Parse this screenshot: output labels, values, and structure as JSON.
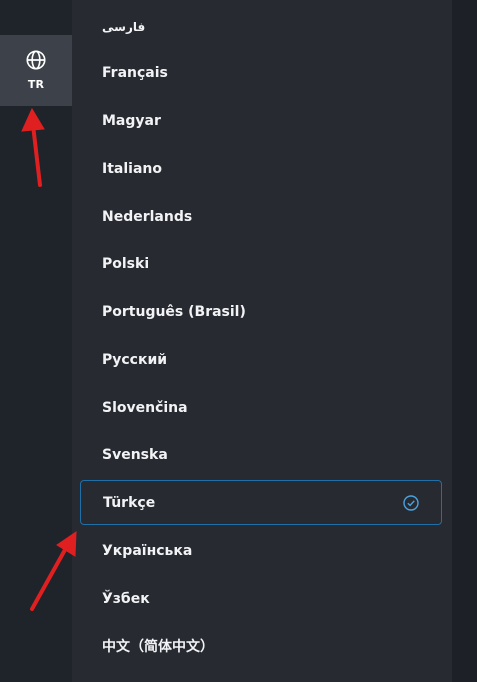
{
  "language_button": {
    "code": "TR",
    "icon": "globe-icon"
  },
  "languages": [
    {
      "label": "فارسی",
      "selected": false
    },
    {
      "label": "Français",
      "selected": false
    },
    {
      "label": "Magyar",
      "selected": false
    },
    {
      "label": "Italiano",
      "selected": false
    },
    {
      "label": "Nederlands",
      "selected": false
    },
    {
      "label": "Polski",
      "selected": false
    },
    {
      "label": "Português (Brasil)",
      "selected": false
    },
    {
      "label": "Русский",
      "selected": false
    },
    {
      "label": "Slovenčina",
      "selected": false
    },
    {
      "label": "Svenska",
      "selected": false
    },
    {
      "label": "Türkçe",
      "selected": true,
      "icon": "check-circle-icon"
    },
    {
      "label": "Українська",
      "selected": false
    },
    {
      "label": "Ўзбек",
      "selected": false
    },
    {
      "label": "中文（简体中文）",
      "selected": false
    }
  ],
  "colors": {
    "accent": "#1f6fa8",
    "check": "#4aa3df",
    "annotation_arrow": "#e02020"
  }
}
